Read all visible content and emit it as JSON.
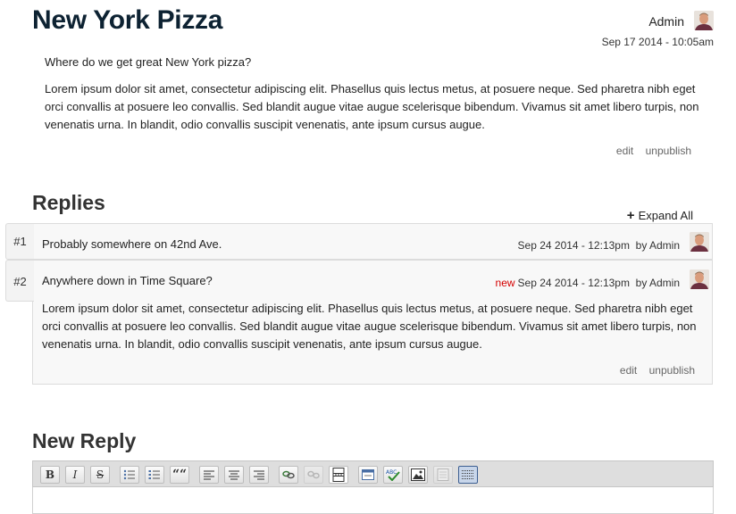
{
  "topic": {
    "title": "New York Pizza",
    "author": "Admin",
    "date": "Sep 17 2014 - 10:05am",
    "question": "Where do we get great New York pizza?",
    "body": "Lorem ipsum dolor sit amet, consectetur adipiscing elit. Phasellus quis lectus metus, at posuere neque. Sed pharetra nibh eget orci convallis at posuere leo convallis. Sed blandit augue vitae augue scelerisque bibendum. Vivamus sit amet libero turpis, non venenatis urna. In blandit, odio convallis suscipit venenatis, ante ipsum cursus augue.",
    "actions": {
      "edit": "edit",
      "unpublish": "unpublish"
    }
  },
  "replies": {
    "heading": "Replies",
    "expand_all": "Expand All",
    "items": [
      {
        "number": "#1",
        "title": "Probably somewhere on 42nd Ave.",
        "new_flag": "",
        "date": "Sep 24 2014 - 12:13pm",
        "by": "by Admin"
      },
      {
        "number": "#2",
        "title": "Anywhere down in Time Square?",
        "new_flag": "new",
        "date": "Sep 24 2014 - 12:13pm",
        "by": "by Admin",
        "body": "Lorem ipsum dolor sit amet, consectetur adipiscing elit. Phasellus quis lectus metus, at posuere neque. Sed pharetra nibh eget orci convallis at posuere leo convallis. Sed blandit augue vitae augue scelerisque bibendum. Vivamus sit amet libero turpis, non venenatis urna. In blandit, odio convallis suscipit venenatis, ante ipsum cursus augue.",
        "actions": {
          "edit": "edit",
          "unpublish": "unpublish"
        }
      }
    ]
  },
  "new_reply": {
    "heading": "New Reply",
    "toolbar": {
      "bold": "B",
      "italic": "I",
      "strike": "S",
      "blockquote": "““",
      "icons": [
        "bold-icon",
        "italic-icon",
        "strikethrough-icon",
        "bulleted-list-icon",
        "numbered-list-icon",
        "blockquote-icon",
        "align-left-icon",
        "align-center-icon",
        "align-right-icon",
        "link-icon",
        "unlink-icon",
        "page-break-icon",
        "template-icon",
        "spellcheck-icon",
        "image-icon",
        "source-icon",
        "show-blocks-icon"
      ]
    }
  },
  "colors": {
    "title": "#0d2232",
    "new_flag": "#d40000",
    "active_button": "#3c5e91"
  }
}
